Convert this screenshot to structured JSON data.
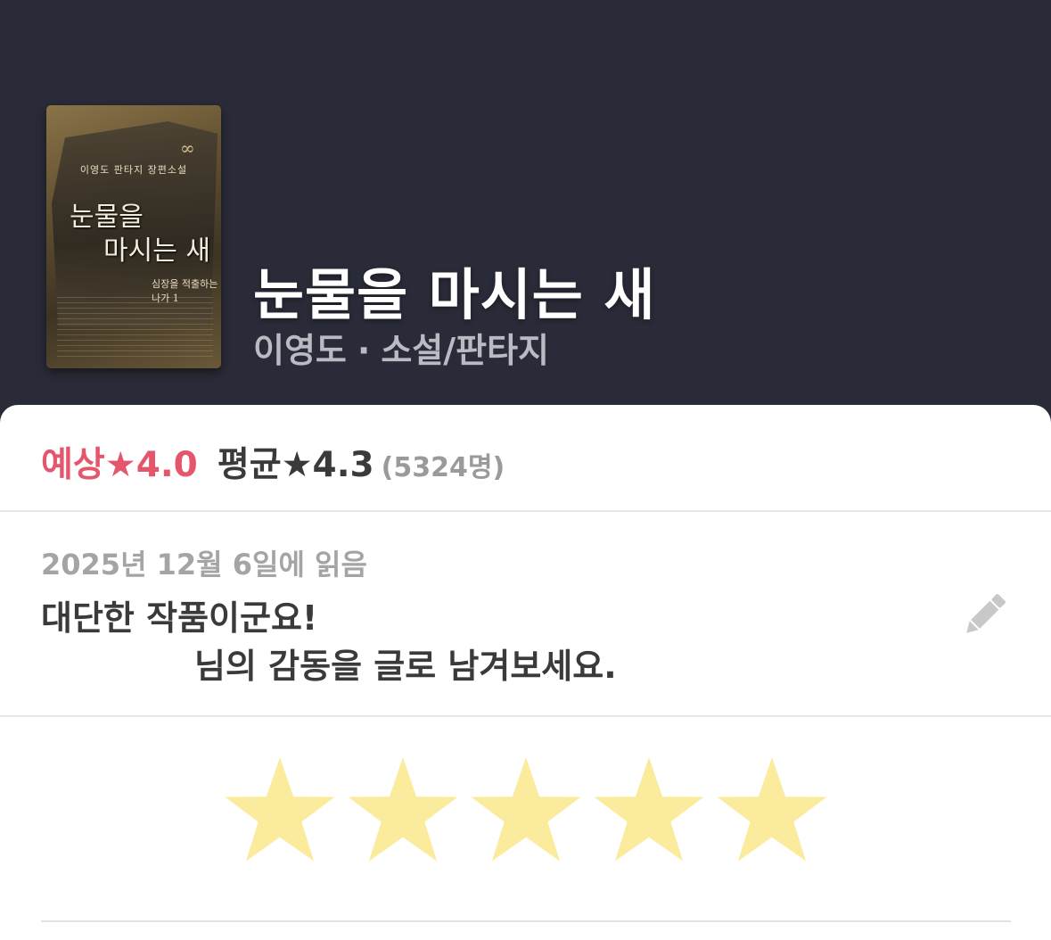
{
  "book": {
    "title": "눈물을 마시는 새",
    "author": "이영도",
    "separator": "·",
    "genre": "소설/판타지",
    "cover": {
      "subtitle": "이영도 판타지 장편소설",
      "title_line1": "눈물을",
      "title_line2": "마시는 새",
      "volume_text": "심장을 적출하는 나가 1"
    }
  },
  "ratings": {
    "expected_label": "예상",
    "expected_value": "★4.0",
    "average_label": "평균",
    "average_value": "★4.3",
    "count": "(5324명)"
  },
  "review": {
    "read_date": "2025년 12월 6일에 읽음",
    "prompt_line1": "대단한 작품이군요!",
    "prompt_line2": "님의 감동을 글로 남겨보세요.",
    "edit_icon": "pencil-icon"
  },
  "rating_input": {
    "max_stars": 5,
    "user_rating": 5,
    "star_color": "#fbeb9c"
  },
  "colors": {
    "header_bg": "#2a2b38",
    "expected": "#e3566b"
  }
}
